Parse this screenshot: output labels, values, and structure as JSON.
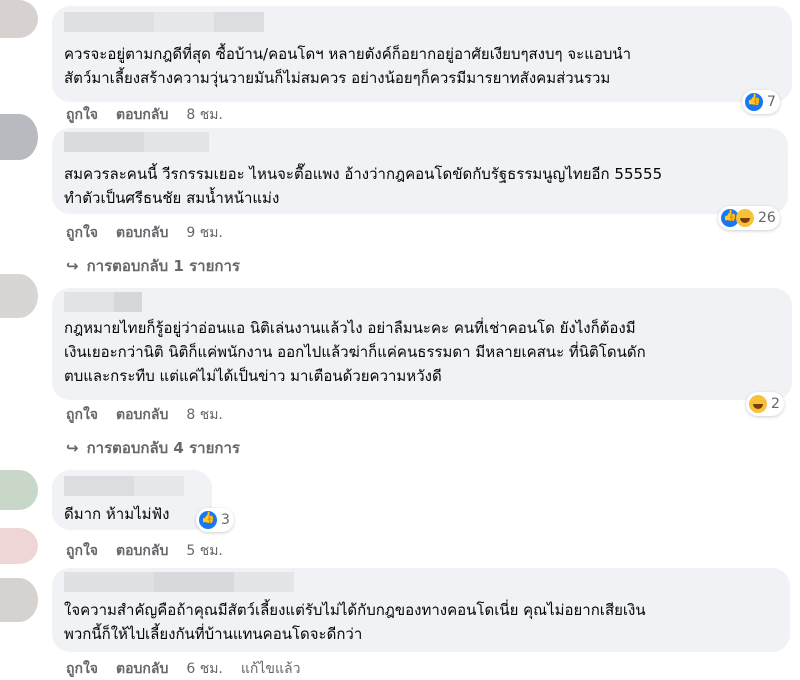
{
  "comments": [
    {
      "text": "ควรจะอยู่ตามกฎดีที่สุด ซื้อบ้าน/คอนโดฯ หลายตังค์ก็อยากอยู่อาศัยเงียบๆสงบๆ จะแอบนำ\nสัตว์มาเลี้ยงสร้างความวุ่นวายมันก็ไม่สมควร อย่างน้อยๆก็ควรมีมารยาทสังคมส่วนรวม",
      "reaction_count": "7",
      "like": "ถูกใจ",
      "reply": "ตอบกลับ",
      "time": "8 ชม."
    },
    {
      "text": "สมควรละคนนี้ วีรกรรมเยอะ ไหนจะตื๊อแพง อ้างว่ากฎคอนโดขัดกับรัฐธรรมนูญไทยอีก 55555\nทำตัวเป็นศรีธนชัย สมน้ำหน้าแม่ง",
      "reaction_count": "26",
      "like": "ถูกใจ",
      "reply": "ตอบกลับ",
      "time": "9 ชม.",
      "replies": "การตอบกลับ 1 รายการ"
    },
    {
      "text": "กฎหมายไทยก็รู้อยู่ว่าอ่อนแอ นิติเล่นงานแล้วไง อย่าลืมนะคะ คนที่เช่าคอนโด ยังไงก็ต้องมี\nเงินเยอะกว่านิติ นิติก็แค่พนักงาน ออกไปแล้วฆ่าก็แค่คนธรรมดา มีหลายเคสนะ ที่นิติโดนดัก\nตบและกระทืบ แต่แค่ไม่ได้เป็นข่าว มาเตือนด้วยความหวังดี",
      "reaction_count": "2",
      "like": "ถูกใจ",
      "reply": "ตอบกลับ",
      "time": "8 ชม.",
      "replies": "การตอบกลับ 4 รายการ"
    },
    {
      "text": "ดีมาก ห้ามไม่ฟัง",
      "reaction_count": "3",
      "like": "ถูกใจ",
      "reply": "ตอบกลับ",
      "time": "5 ชม."
    },
    {
      "text": "ใจความสำคัญคือถ้าคุณมีสัตว์เลี้ยงแต่รับไม่ได้กับกฎของทางคอนโดเนี่ย คุณไม่อยากเสียเงิน\nพวกนี้ก็ให้ไปเลี้ยงกันที่บ้านแทนคอนโดจะดีกว่า",
      "like": "ถูกใจ",
      "reply": "ตอบกลับ",
      "time": "6 ชม.",
      "edited": "แก้ไขแล้ว"
    }
  ],
  "colors": {
    "bubble": "#f0f2f5",
    "meta_text": "#65676b",
    "like_blue": "#1877f2",
    "haha_yellow": "#f7c23a"
  }
}
